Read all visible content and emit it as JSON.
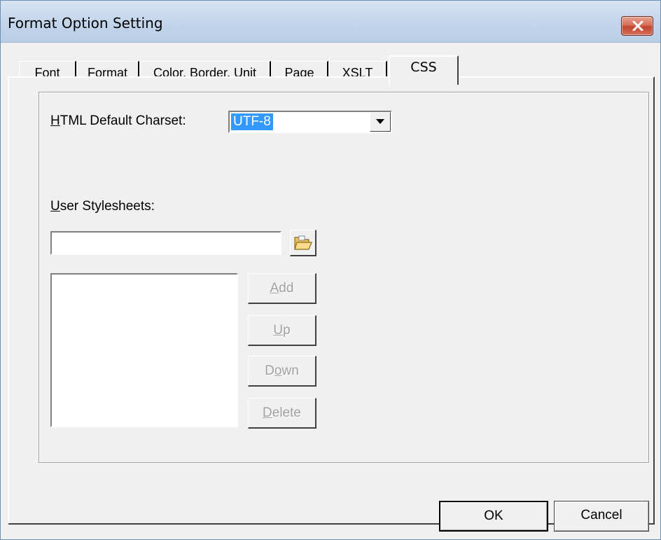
{
  "window": {
    "title": "Format Option Setting"
  },
  "tabs": [
    {
      "label": "Font",
      "active": false
    },
    {
      "label": "Format",
      "active": false
    },
    {
      "label": "Color, Border, Unit",
      "active": false
    },
    {
      "label": "Page",
      "active": false
    },
    {
      "label": "XSLT",
      "active": false
    },
    {
      "label": "CSS",
      "active": true
    }
  ],
  "css_panel": {
    "charset_label_mnemonic": "H",
    "charset_label_rest": "TML Default Charset:",
    "charset_value": "UTF-8",
    "stylesheets_label_mnemonic": "U",
    "stylesheets_label_rest": "ser Stylesheets:",
    "stylesheet_path": "",
    "stylesheets_list": [],
    "buttons": {
      "add": {
        "mnemonic": "A",
        "rest": "dd"
      },
      "up": {
        "mnemonic": "U",
        "rest": "p"
      },
      "down_pre": "D",
      "down_mnemonic": "o",
      "down_post": "wn",
      "delete": {
        "mnemonic": "D",
        "rest": "elete"
      }
    }
  },
  "footer": {
    "ok": "OK",
    "cancel": "Cancel"
  },
  "colors": {
    "selection": "#3399ff",
    "close_button": "#c75a43",
    "dialog_bg": "#f0f0f0"
  }
}
